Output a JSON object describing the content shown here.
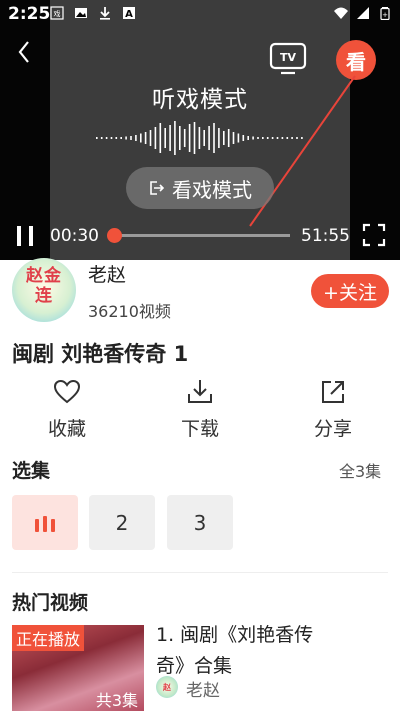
{
  "status_bar": {
    "time": "2:25",
    "icons": [
      "app-logo-icon",
      "image-icon",
      "download-icon",
      "font-icon",
      "wifi-icon",
      "signal-icon",
      "battery-icon"
    ]
  },
  "player": {
    "mode_title": "听戏模式",
    "switch_mode_label": "看戏模式",
    "watch_badge": "看",
    "tv_label": "TV",
    "current_time": "00:30",
    "duration": "51:55",
    "progress_fraction": 0.0096,
    "colors": {
      "accent": "#f0523a",
      "player_bg": "#3c3c3c"
    }
  },
  "uploader": {
    "avatar_text": "赵金连",
    "name": "老赵",
    "video_count": "36210视频",
    "follow_label": "+关注"
  },
  "video": {
    "title": "闽剧 刘艳香传奇 1"
  },
  "actions": [
    {
      "label": "收藏",
      "icon": "heart-icon"
    },
    {
      "label": "下载",
      "icon": "download-icon"
    },
    {
      "label": "分享",
      "icon": "share-icon"
    }
  ],
  "episodes": {
    "title": "选集",
    "count_label": "全3集",
    "items": [
      {
        "label": "",
        "playing": true
      },
      {
        "label": "2",
        "playing": false
      },
      {
        "label": "3",
        "playing": false
      }
    ]
  },
  "hot": {
    "title": "热门视频",
    "items": [
      {
        "badge": "正在播放",
        "episodes": "共3集",
        "title_line1": "1. 闽剧《刘艳香传",
        "title_line2": "奇》合集",
        "author": "老赵"
      }
    ]
  }
}
